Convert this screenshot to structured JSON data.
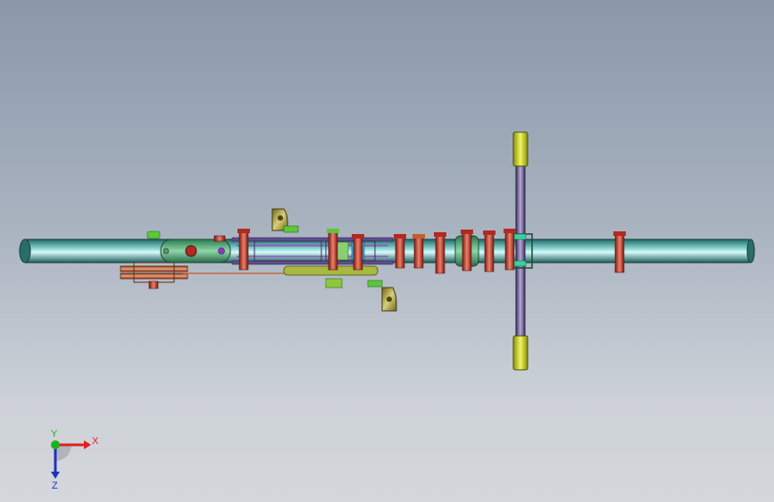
{
  "view": {
    "background_top": "#8b98aa",
    "background_bottom": "#d4d7db"
  },
  "model": {
    "description_icon": "cad-assembly-top-view",
    "tube_color": "#2e8a84",
    "tube_highlight": "#bfeff0",
    "bolt_color": "#c8322a",
    "bracket_color": "#a89a3a",
    "strut_color": "#6b5f8a",
    "grip_color": "#d8e02a",
    "pulley_color": "#c86a3c",
    "frame_color": "#2f7a52",
    "accent_purple": "#9b3ac0",
    "accent_cyan": "#2ab8e0",
    "accent_green": "#5ac83a"
  },
  "triad": {
    "x_label": "X",
    "y_label": "Y",
    "z_label": "Z",
    "x_color": "#e02020",
    "y_color": "#20b020",
    "z_color": "#2030c0"
  }
}
